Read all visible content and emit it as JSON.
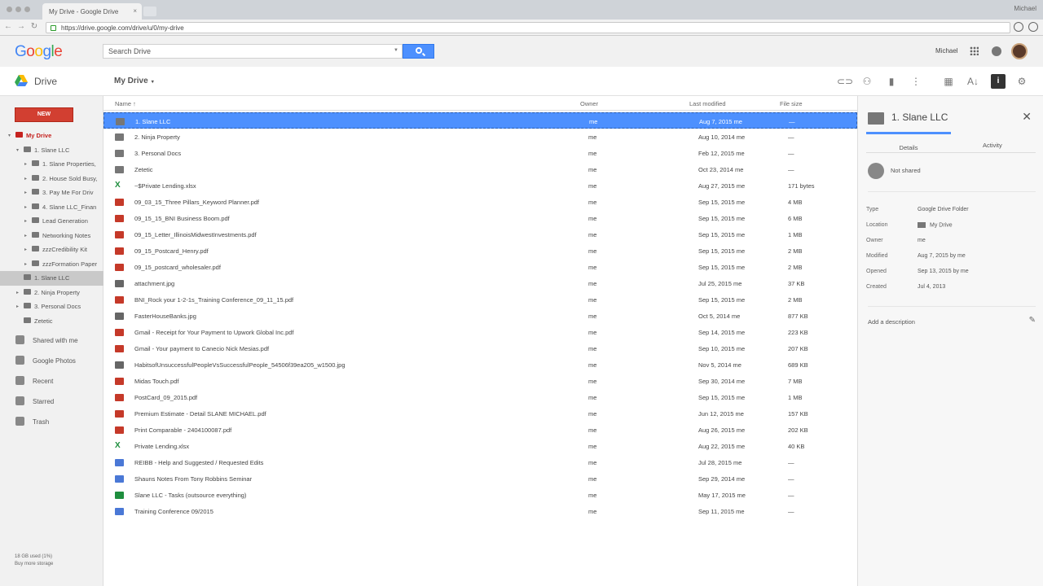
{
  "browser": {
    "tab_title": "My Drive - Google Drive",
    "tab_close": "×",
    "profile": "Michael",
    "url": "https://drive.google.com/drive/u/0/my-drive"
  },
  "header": {
    "search_placeholder": "Search Drive",
    "user": "Michael"
  },
  "drivebar": {
    "product": "Drive",
    "location": "My Drive",
    "location_caret": "▾"
  },
  "sidebar": {
    "new_label": "NEW",
    "tree": [
      {
        "label": "My Drive",
        "depth": 0,
        "arrow": "▾",
        "mine": true
      },
      {
        "label": "1. Slane LLC",
        "depth": 1,
        "arrow": "▾"
      },
      {
        "label": "1. Slane Properties,",
        "depth": 2,
        "arrow": "▸"
      },
      {
        "label": "2. House Sold Busy,",
        "depth": 2,
        "arrow": "▸"
      },
      {
        "label": "3. Pay Me For Driv",
        "depth": 2,
        "arrow": "▸"
      },
      {
        "label": "4. Slane LLC_Finan",
        "depth": 2,
        "arrow": "▸"
      },
      {
        "label": "Lead Generation",
        "depth": 2,
        "arrow": "▸"
      },
      {
        "label": "Networking Notes",
        "depth": 2,
        "arrow": "▸"
      },
      {
        "label": "zzzCredibility Kit",
        "depth": 2,
        "arrow": "▸"
      },
      {
        "label": "zzzFormation Paper",
        "depth": 2,
        "arrow": "▸"
      },
      {
        "label": "1. Slane LLC",
        "depth": 1,
        "arrow": "",
        "highlight": true
      },
      {
        "label": "2. Ninja Property",
        "depth": 1,
        "arrow": "▸"
      },
      {
        "label": "3. Personal Docs",
        "depth": 1,
        "arrow": "▸"
      },
      {
        "label": "Zetetic",
        "depth": 1,
        "arrow": ""
      }
    ],
    "nav": [
      {
        "label": "Shared with me",
        "icon": "people-icon"
      },
      {
        "label": "Google Photos",
        "icon": "photos-icon"
      },
      {
        "label": "Recent",
        "icon": "clock-icon"
      },
      {
        "label": "Starred",
        "icon": "star-icon"
      },
      {
        "label": "Trash",
        "icon": "trash-icon"
      }
    ],
    "storage_used": "18 GB used (1%)",
    "buy_storage": "Buy more storage"
  },
  "list": {
    "columns": {
      "name": "Name ↑",
      "owner": "Owner",
      "modified": "Last modified",
      "size": "File size"
    },
    "rows": [
      {
        "name": "1. Slane LLC",
        "type": "folder",
        "owner": "me",
        "modified": "Aug 7, 2015 me",
        "size": "—",
        "selected": true
      },
      {
        "name": "2. Ninja Property",
        "type": "folder",
        "owner": "me",
        "modified": "Aug 10, 2014 me",
        "size": "—"
      },
      {
        "name": "3. Personal Docs",
        "type": "folder",
        "owner": "me",
        "modified": "Feb 12, 2015 me",
        "size": "—"
      },
      {
        "name": "Zetetic",
        "type": "folder",
        "owner": "me",
        "modified": "Oct 23, 2014 me",
        "size": "—"
      },
      {
        "name": "~$Private Lending.xlsx",
        "type": "xls",
        "owner": "me",
        "modified": "Aug 27, 2015 me",
        "size": "171 bytes"
      },
      {
        "name": "09_03_15_Three Pillars_Keyword Planner.pdf",
        "type": "pdf",
        "owner": "me",
        "modified": "Sep 15, 2015 me",
        "size": "4 MB"
      },
      {
        "name": "09_15_15_BNI Business Boom.pdf",
        "type": "pdf",
        "owner": "me",
        "modified": "Sep 15, 2015 me",
        "size": "6 MB"
      },
      {
        "name": "09_15_Letter_IllinoisMidwestInvestments.pdf",
        "type": "pdf",
        "owner": "me",
        "modified": "Sep 15, 2015 me",
        "size": "1 MB"
      },
      {
        "name": "09_15_Postcard_Henry.pdf",
        "type": "pdf",
        "owner": "me",
        "modified": "Sep 15, 2015 me",
        "size": "2 MB"
      },
      {
        "name": "09_15_postcard_wholesaler.pdf",
        "type": "pdf",
        "owner": "me",
        "modified": "Sep 15, 2015 me",
        "size": "2 MB"
      },
      {
        "name": "attachment.jpg",
        "type": "img",
        "owner": "me",
        "modified": "Jul 25, 2015 me",
        "size": "37 KB"
      },
      {
        "name": "BNI_Rock your 1-2-1s_Training Conference_09_11_15.pdf",
        "type": "pdf",
        "owner": "me",
        "modified": "Sep 15, 2015 me",
        "size": "2 MB"
      },
      {
        "name": "FasterHouseBanks.jpg",
        "type": "img",
        "owner": "me",
        "modified": "Oct 5, 2014 me",
        "size": "877 KB"
      },
      {
        "name": "Gmail - Receipt for Your Payment to Upwork Global Inc.pdf",
        "type": "pdf",
        "owner": "me",
        "modified": "Sep 14, 2015 me",
        "size": "223 KB"
      },
      {
        "name": "Gmail - Your payment to Canecio Nick Mesias.pdf",
        "type": "pdf",
        "owner": "me",
        "modified": "Sep 10, 2015 me",
        "size": "207 KB"
      },
      {
        "name": "HabitsofUnsuccessfulPeopleVsSuccessfulPeople_54506f39ea205_w1500.jpg",
        "type": "img",
        "owner": "me",
        "modified": "Nov 5, 2014 me",
        "size": "689 KB"
      },
      {
        "name": "Midas Touch.pdf",
        "type": "pdf",
        "owner": "me",
        "modified": "Sep 30, 2014 me",
        "size": "7 MB"
      },
      {
        "name": "PostCard_09_2015.pdf",
        "type": "pdf",
        "owner": "me",
        "modified": "Sep 15, 2015 me",
        "size": "1 MB"
      },
      {
        "name": "Premium Estimate - Detail SLANE MICHAEL.pdf",
        "type": "pdf",
        "owner": "me",
        "modified": "Jun 12, 2015 me",
        "size": "157 KB"
      },
      {
        "name": "Print Comparable - 2404100087.pdf",
        "type": "pdf",
        "owner": "me",
        "modified": "Aug 26, 2015 me",
        "size": "202 KB"
      },
      {
        "name": "Private Lending.xlsx",
        "type": "xls",
        "owner": "me",
        "modified": "Aug 22, 2015 me",
        "size": "40 KB"
      },
      {
        "name": "REIBB - Help and Suggested / Requested Edits",
        "type": "doc",
        "owner": "me",
        "modified": "Jul 28, 2015 me",
        "size": "—"
      },
      {
        "name": "Shauns Notes From Tony Robbins Seminar",
        "type": "doc",
        "owner": "me",
        "modified": "Sep 29, 2014 me",
        "size": "—"
      },
      {
        "name": "Slane LLC - Tasks (outsource everything)",
        "type": "sheet",
        "owner": "me",
        "modified": "May 17, 2015 me",
        "size": "—"
      },
      {
        "name": "Training Conference 09/2015",
        "type": "doc",
        "owner": "me",
        "modified": "Sep 11, 2015 me",
        "size": "—"
      }
    ]
  },
  "panel": {
    "title": "1. Slane LLC",
    "close": "✕",
    "tab_details": "Details",
    "tab_activity": "Activity",
    "sharing": "Not shared",
    "props": [
      {
        "k": "Type",
        "v": "Google Drive Folder"
      },
      {
        "k": "Location",
        "v": "My Drive",
        "folder": true
      },
      {
        "k": "Owner",
        "v": "me"
      },
      {
        "k": "Modified",
        "v": "Aug 7, 2015 by me"
      },
      {
        "k": "Opened",
        "v": "Sep 13, 2015 by me"
      },
      {
        "k": "Created",
        "v": "Jul 4, 2013"
      }
    ],
    "add_description": "Add a description"
  }
}
